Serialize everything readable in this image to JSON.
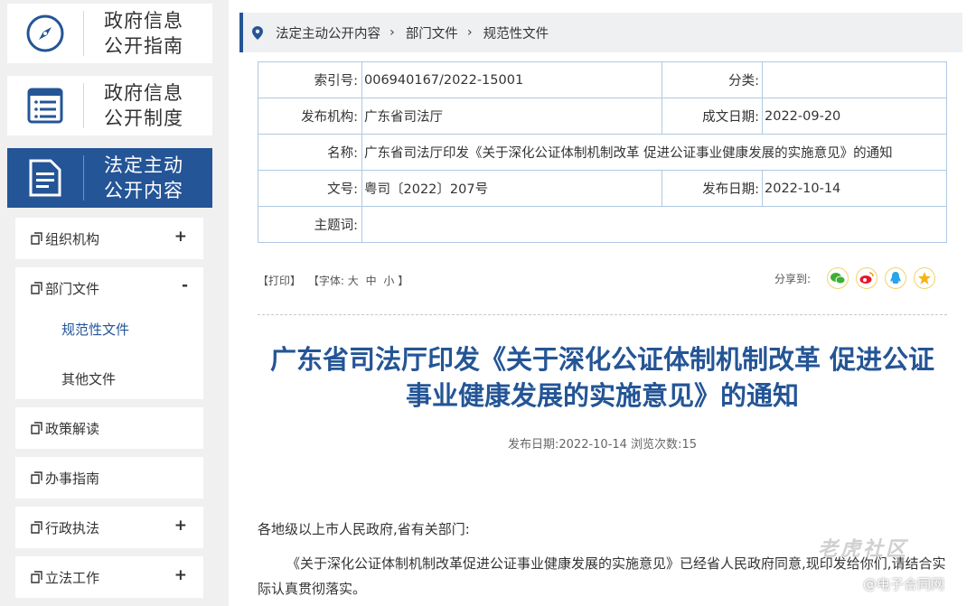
{
  "sidebar": {
    "cards": [
      {
        "title": "政府信息\n公开指南"
      },
      {
        "title": "政府信息\n公开制度"
      },
      {
        "title": "法定主动\n公开内容"
      }
    ],
    "menu": {
      "org": {
        "label": "组织机构",
        "sign": "+"
      },
      "dept": {
        "label": "部门文件",
        "sign": "-"
      },
      "sub_normative": "规范性文件",
      "sub_other": "其他文件",
      "policy": {
        "label": "政策解读"
      },
      "guide": {
        "label": "办事指南"
      },
      "enforce": {
        "label": "行政执法",
        "sign": "+"
      },
      "legis": {
        "label": "立法工作",
        "sign": "+"
      }
    }
  },
  "breadcrumb": {
    "items": [
      "法定主动公开内容",
      "部门文件",
      "规范性文件"
    ]
  },
  "meta": {
    "index_label": "索引号:",
    "index_value": "006940167/2022-15001",
    "category_label": "分类:",
    "category_value": "",
    "issuer_label": "发布机构:",
    "issuer_value": "广东省司法厅",
    "made_label": "成文日期:",
    "made_value": "2022-09-20",
    "name_label": "名称:",
    "name_value": "广东省司法厅印发《关于深化公证体制机制改革 促进公证事业健康发展的实施意见》的通知",
    "docno_label": "文号:",
    "docno_value": "粤司〔2022〕207号",
    "pub_label": "发布日期:",
    "pub_value": "2022-10-14",
    "subject_label": "主题词:",
    "subject_value": ""
  },
  "tools": {
    "print": "【打印】",
    "font_prefix": "【字体:",
    "large": "大",
    "medium": "中",
    "small": "小",
    "font_suffix": "】",
    "share_label": "分享到:"
  },
  "article": {
    "title": "广东省司法厅印发《关于深化公证体制机制改革 促进公证事业健康发展的实施意见》的通知",
    "subline": "发布日期:2022-10-14  浏览次数:15",
    "salutation": "各地级以上市人民政府,省有关部门:",
    "para1": "《关于深化公证体制机制改革促进公证事业健康发展的实施意见》已经省人民政府同意,现印发给你们,请结合实际认真贯彻落实。"
  },
  "watermark": {
    "line1": "老虎社区",
    "line2": "@电子合同网"
  },
  "colors": {
    "brand_blue": "#245596",
    "border_blue": "#aec9e2"
  }
}
